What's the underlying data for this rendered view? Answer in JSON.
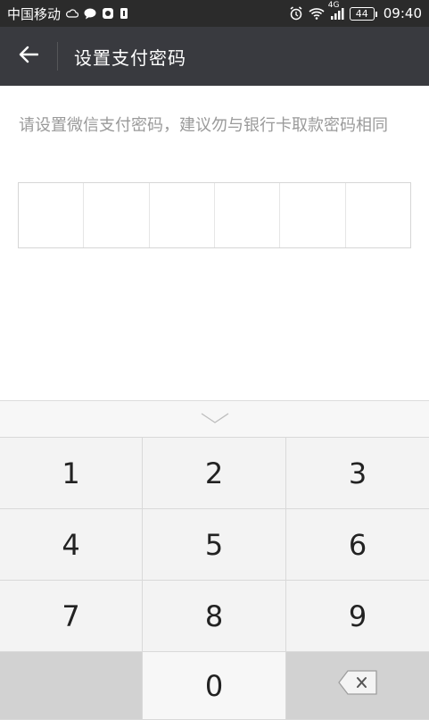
{
  "status_bar": {
    "carrier": "中国移动",
    "network": "4G",
    "battery": "44",
    "time": "09:40",
    "icons": [
      "cloud-icon",
      "chat-bubble-icon",
      "app-icon",
      "sim-icon",
      "alarm-icon",
      "wifi-icon",
      "signal-icon"
    ]
  },
  "header": {
    "back_icon": "arrow-left-icon",
    "title": "设置支付密码"
  },
  "hint": "请设置微信支付密码，建议勿与银行卡取款密码相同",
  "password": {
    "length": 6
  },
  "keypad": {
    "collapse_icon": "chevron-down-icon",
    "keys": [
      "1",
      "2",
      "3",
      "4",
      "5",
      "6",
      "7",
      "8",
      "9",
      "",
      "0",
      "delete"
    ],
    "delete_icon": "backspace-icon"
  },
  "colors": {
    "status_bar": "#2b2b2b",
    "title_bar": "#393a3f",
    "key_bg": "#f3f3f3",
    "key_dark_bg": "#d2d2d2",
    "hint_text": "#9a9a9a"
  }
}
